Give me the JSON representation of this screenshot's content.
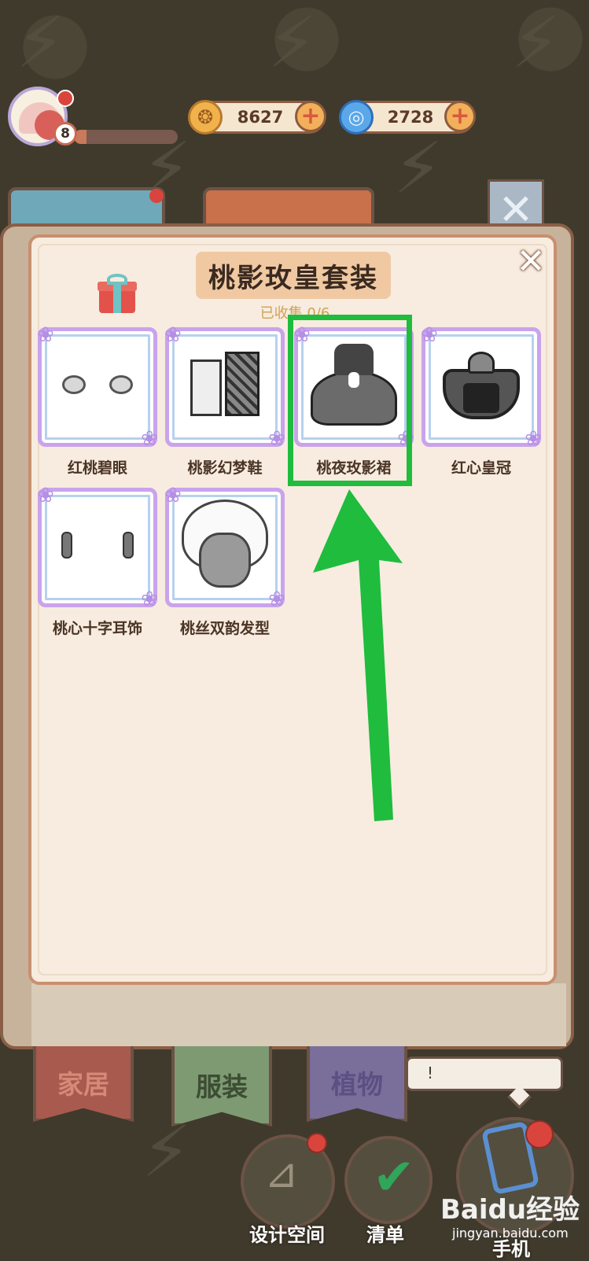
{
  "header": {
    "level": "8",
    "xp_progress": 0.12,
    "gold_value": "8627",
    "gold_icon": "gold-coin-icon",
    "blue_value": "2728",
    "blue_icon": "blue-swirl-icon",
    "plus_symbol": "+"
  },
  "dialog": {
    "title": "桃影玫皇套装",
    "collected": "已收集 0/6",
    "close_symbol": "✕"
  },
  "items": [
    {
      "label": "红桃碧眼"
    },
    {
      "label": "桃影幻梦鞋"
    },
    {
      "label": "桃夜玫影裙"
    },
    {
      "label": "红心皇冠"
    },
    {
      "label": "桃心十字耳饰"
    },
    {
      "label": "桃丝双韵发型"
    }
  ],
  "tabs": {
    "home": "家居",
    "clothing": "服装",
    "plants": "植物"
  },
  "bubble_text": "!",
  "bottom_buttons": {
    "design_space": "设计空间",
    "list": "清单",
    "phone": "手机"
  },
  "watermark": {
    "brand": "Baidu经验",
    "url": "jingyan.baidu.com"
  },
  "colors": {
    "highlight": "#1fbc3e",
    "panel_bg": "#f7ecdf",
    "item_border": "#c9a3ec"
  }
}
